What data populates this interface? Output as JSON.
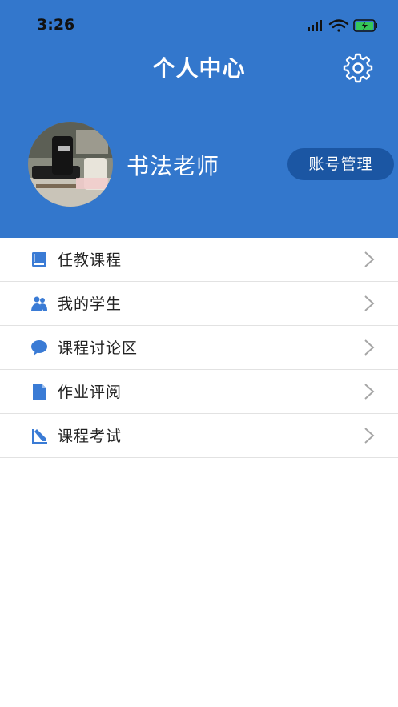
{
  "status": {
    "time": "3:26"
  },
  "header": {
    "title": "个人中心"
  },
  "profile": {
    "name": "书法老师",
    "account_button": "账号管理"
  },
  "menu": {
    "items": [
      {
        "label": "任教课程",
        "icon": "book-icon"
      },
      {
        "label": "我的学生",
        "icon": "people-icon"
      },
      {
        "label": "课程讨论区",
        "icon": "chat-bubble-icon"
      },
      {
        "label": "作业评阅",
        "icon": "document-icon"
      },
      {
        "label": "课程考试",
        "icon": "pencil-edit-icon"
      }
    ]
  },
  "colors": {
    "header_bg": "#3377cc",
    "button_bg": "#1b56a3",
    "icon_blue": "#3a7bd5",
    "divider": "#e2e2e2"
  }
}
